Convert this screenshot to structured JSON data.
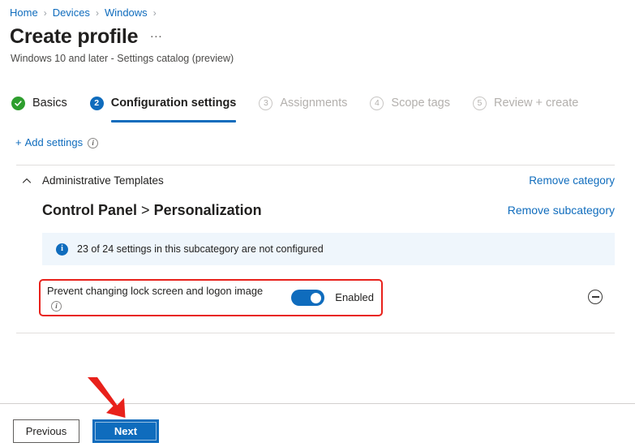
{
  "breadcrumb": {
    "items": [
      "Home",
      "Devices",
      "Windows"
    ],
    "separator": "›",
    "trailing_separator": "›"
  },
  "header": {
    "title": "Create profile",
    "more_label": "…",
    "subtitle": "Windows 10 and later - Settings catalog (preview)"
  },
  "wizard": {
    "tabs": [
      {
        "badge": "✓",
        "label": "Basics",
        "state": "done"
      },
      {
        "badge": "2",
        "label": "Configuration settings",
        "state": "active"
      },
      {
        "badge": "3",
        "label": "Assignments",
        "state": "future"
      },
      {
        "badge": "4",
        "label": "Scope tags",
        "state": "future"
      },
      {
        "badge": "5",
        "label": "Review + create",
        "state": "future"
      }
    ]
  },
  "toolbar": {
    "add_settings_plus": "+",
    "add_settings_label": "Add settings",
    "info_glyph": "i"
  },
  "category": {
    "chevron": "chevron-up-icon",
    "name": "Administrative Templates",
    "remove_label": "Remove category"
  },
  "subcategory": {
    "parent": "Control Panel",
    "separator": ">",
    "name": "Personalization",
    "remove_label": "Remove subcategory"
  },
  "banner": {
    "icon_glyph": "i",
    "text": "23 of 24 settings in this subcategory are not configured"
  },
  "setting": {
    "label": "Prevent changing lock screen and logon image",
    "info_glyph": "i",
    "toggle_state": "on",
    "toggle_text": "Enabled",
    "remove_icon": "minus-circle-icon"
  },
  "footer": {
    "previous_label": "Previous",
    "next_label": "Next"
  },
  "annotation": {
    "arrow_color": "#e8211b",
    "highlight_color": "#e8211b",
    "target": "Next"
  },
  "colors": {
    "accent": "#0f6cbd",
    "link": "#0f6cbd",
    "success": "#2e9e2e",
    "banner_bg": "#eff6fc",
    "disabled_text": "#b3b0ad"
  }
}
